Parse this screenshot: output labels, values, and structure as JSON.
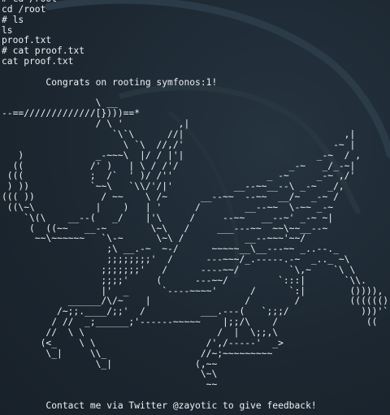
{
  "terminal": {
    "lines": [
      "# cd /root",
      "cd /root",
      "# ls",
      "ls",
      "proof.txt",
      "# cat proof.txt",
      "cat proof.txt",
      "",
      "        Congrats on rooting symfonos:1!",
      "",
      "                 \\ __",
      "--==/////////////[})))==*",
      "                 / \\ '          ,|",
      "                    `\\`\\      //|                             ,|",
      "                      \\ `\\  //,/'                           -~ |",
      "   )             _-~~~\\  |/ / |'|                        _-~  / ,",
      "  ((            /' )   | \\ / /'/                    _-~   _/_-~|",
      " (((            ;  /`  ' )/ /''                 _ -~     _-~ ,/'",
      " ) ))           `~~\\   `\\\\/'/|'           __--~~__--\\ _-~  _/,",
      "((( ))            / ~~    \\ /~      __--~~  --~~  __/~  _-~ /",
      " ((\\~\\           |    )   | '      /        __--~~  \\-~~ _-~",
      "    `\\(\\    __--(   _/    |'\\     /     --~~   __--~' _-~ ~|",
      "     (  ((~~   __-~        \\~\\   /     ___---~~  ~~\\~~__--~",
      "      ~~\\~~~~~~   `\\-~      \\~\\ /           __--~~~'~~/",
      "                   ;\\ __.-~  ~-/      ~~~~~__\\__---~~ _..--._",
      "                   ;;;;;;;;'  /      ---~~~/_.-----.-~  _.._ ~\\",
      "                  ;;;;;;;'   /      ----~~/         `\\,~    `\\ \\",
      "                  ;;;;'     (      ---~~/         `:::|       `\\\\.",
      "                  |'  _      `----~~~~'      /      `:|        ()))),",
      "            ______/\\/~    |                 /        /         (((((())",
      "          /~;;.____/;;'  /          ___.---(   `;;;/             )))'`))",
      "         / //  _;______;'------~~~~~    |;;/\\    /                ((   (",
      "        //  \\ \\                        /  |  \\;;,\\",
      "       (<_    \\ \\                    /',/-----'  _>",
      "        \\_|     \\\\_                 //~;~~~~~~~~~",
      "                 \\_|               (,~~",
      "                                    \\~\\",
      "                                     ~~",
      "",
      "        Contact me via Twitter @zayotic to give feedback!"
    ]
  }
}
